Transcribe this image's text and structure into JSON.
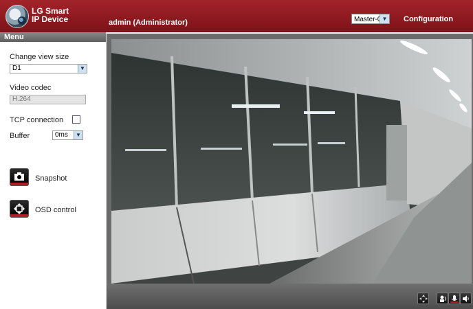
{
  "header": {
    "brand_line1": "LG Smart",
    "brand_line2": "IP Device",
    "user": "admin (Administrator)",
    "stream_select": "Master-0",
    "config_link": "Configuration"
  },
  "sidebar": {
    "menu_title": "Menu",
    "view_size_label": "Change view size",
    "view_size_value": "D1",
    "codec_label": "Video codec",
    "codec_value": "H.264",
    "tcp_label": "TCP connection",
    "tcp_checked": false,
    "buffer_label": "Buffer",
    "buffer_value": "0ms",
    "snapshot_label": "Snapshot",
    "osd_label": "OSD control"
  },
  "controls": {
    "icons": [
      "move-icon",
      "speaker-talk-icon",
      "microphone-icon",
      "volume-icon"
    ]
  },
  "colors": {
    "header_red": "#8d1a21",
    "accent_red": "#b01c24"
  }
}
